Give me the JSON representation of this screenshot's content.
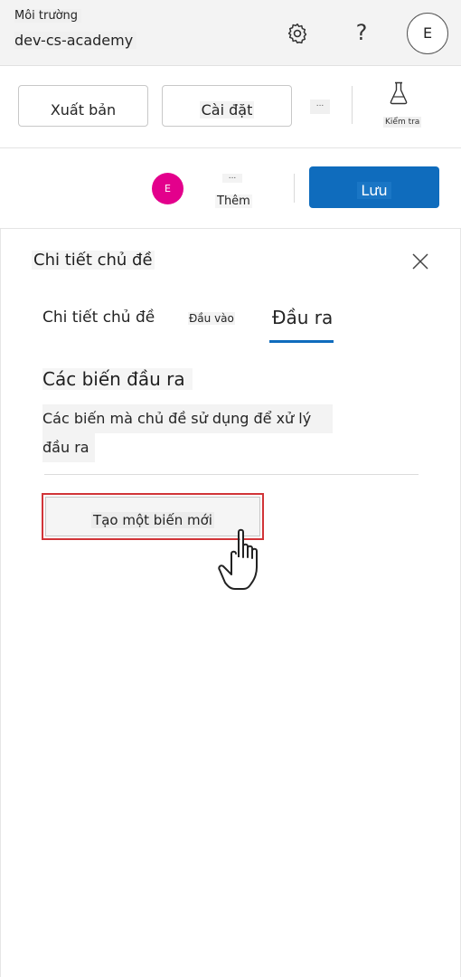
{
  "topbar": {
    "environment_label": "Môi trường",
    "environment_name": "dev-cs-academy",
    "help_label": "?",
    "account_initial": "E",
    "icons": {
      "settings": "gear-icon",
      "account": "avatar"
    }
  },
  "toolbar": {
    "publish_label": "Xuất bản",
    "settings_label": "Cài đặt",
    "more_label": "...",
    "test_label": "Kiểm tra",
    "icons": {
      "test": "flask-icon"
    }
  },
  "action_row": {
    "user_initial": "E",
    "more_dots": "...",
    "more_label": "Thêm",
    "save_label": "Lưu"
  },
  "panel": {
    "title": "Chi tiết chủ đề",
    "tabs": [
      {
        "label": "Chi tiết chủ đề",
        "selected": false
      },
      {
        "label": "Đầu vào",
        "selected": false
      },
      {
        "label": "Đầu ra",
        "selected": true
      }
    ],
    "section_heading": "Các biến đầu ra",
    "section_desc_line1": "Các biến mà chủ đề sử dụng để xử lý",
    "section_desc_line2": "đầu ra",
    "create_button_label": "Tạo một biến mới"
  },
  "colors": {
    "accent": "#0f6cbd",
    "avatar_pink": "#e3008c",
    "highlight_red": "#d13438"
  }
}
